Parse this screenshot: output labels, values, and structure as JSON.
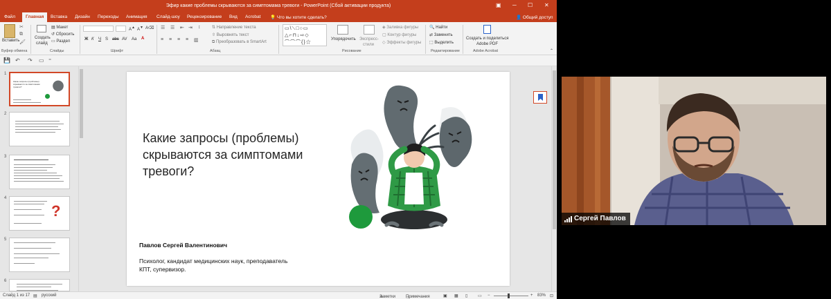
{
  "window": {
    "title": "Эфир какие проблемы скрываются за симптомама тревоги - PowerPoint (Сбой активации продукта)"
  },
  "tabs": [
    "Файл",
    "Главная",
    "Вставка",
    "Дизайн",
    "Переходы",
    "Анимация",
    "Слайд-шоу",
    "Рецензирование",
    "Вид",
    "Acrobat"
  ],
  "active_tab": "Главная",
  "tell_me": "Что вы хотите сделать?",
  "share": "Общий доступ",
  "ribbon": {
    "paste": "Вставить",
    "clipboard_group": "Буфер обмена",
    "create_slide": "Создать",
    "create_slide2": "слайд",
    "layout": "Макет",
    "reset": "Сбросить",
    "section": "Раздел",
    "slides_group": "Слайды",
    "font_group": "Шрифт",
    "text_direction": "Направление текста",
    "align_text": "Выровнять текст",
    "smartart": "Преобразовать в SmartArt",
    "paragraph_group": "Абзац",
    "arrange": "Упорядочить",
    "quick_styles": "Экспресс-",
    "quick_styles2": "стили",
    "shape_fill": "Заливка фигуры",
    "shape_outline": "Контур фигуры",
    "shape_effects": "Эффекты фигуры",
    "drawing_group": "Рисование",
    "find": "Найти",
    "replace": "Заменить",
    "select": "Выделить",
    "editing_group": "Редактирование",
    "create_share": "Создать и поделиться",
    "adobe_pdf": "Adobe PDF",
    "acrobat_group": "Adobe Acrobat"
  },
  "slide": {
    "title": "Какие запросы (проблемы) скрываются за симптомами тревоги?",
    "author": "Павлов Сергей Валентинович",
    "description_line1": "Психолог, кандидат медицинских наук, преподаватель",
    "description_line2": "КПТ, супервизор."
  },
  "thumbnails": [
    {
      "num": "1",
      "text": "Какие запросы (проблемы) скрываются за симптомами тревоги?"
    },
    {
      "num": "2",
      "text": ""
    },
    {
      "num": "3",
      "text": ""
    },
    {
      "num": "4",
      "text": ""
    },
    {
      "num": "5",
      "text": ""
    },
    {
      "num": "6",
      "text": ""
    }
  ],
  "status": {
    "slide_info": "Слайд 1 из 17",
    "language": "русский",
    "notes": "Заметки",
    "comments": "Примечания",
    "zoom": "83%"
  },
  "video": {
    "participant_name": "Сергей Павлов"
  },
  "colors": {
    "accent": "#c43e1c",
    "illustration_green": "#1e9a3c",
    "ghost_gray": "#616b70"
  }
}
